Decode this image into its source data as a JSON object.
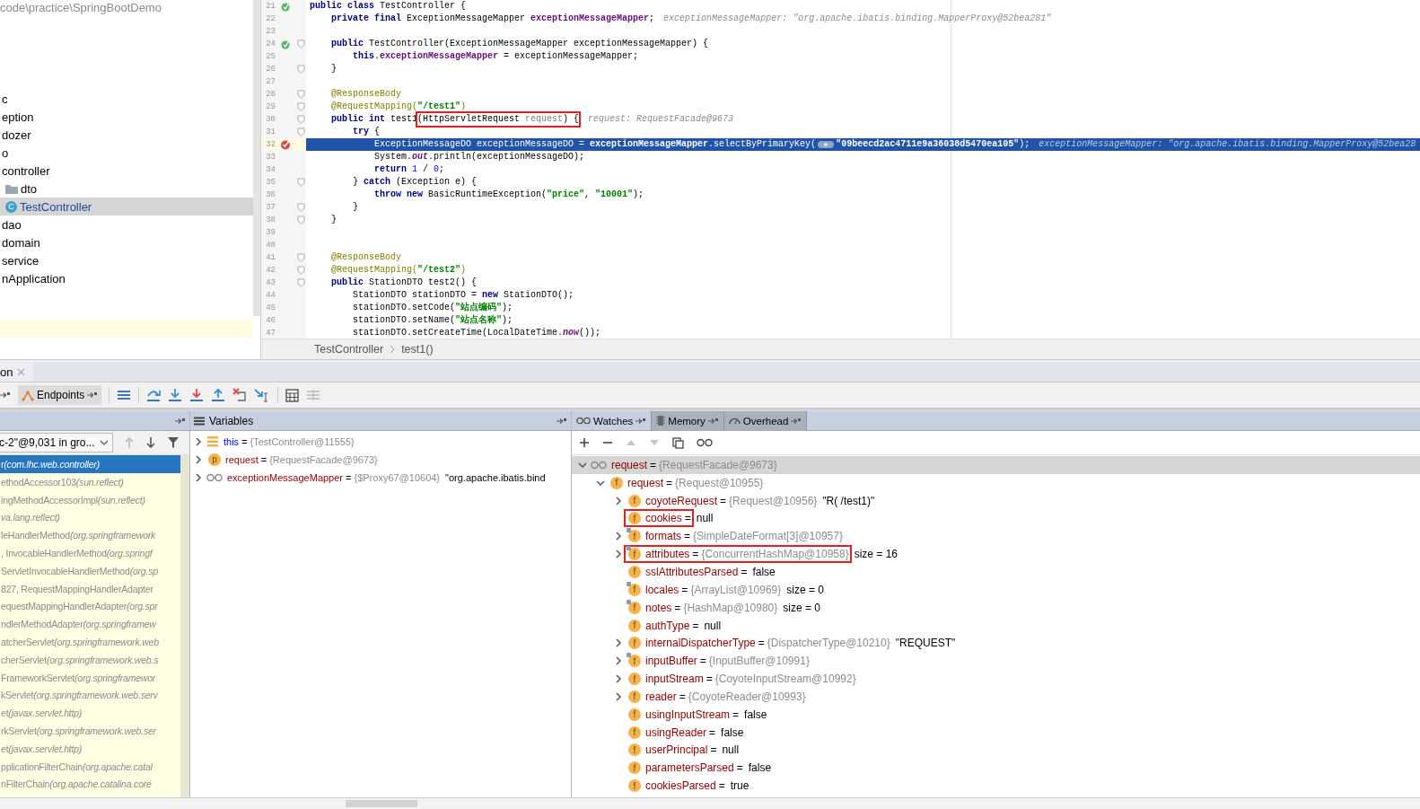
{
  "project_tree": {
    "path": "code\\practice\\SpringBootDemo",
    "items": [
      {
        "label": "c",
        "selected": false
      },
      {
        "label": "eption",
        "selected": false
      },
      {
        "label": "dozer",
        "selected": false
      },
      {
        "label": "o",
        "selected": false
      },
      {
        "label": "controller",
        "selected": false,
        "children": [
          {
            "label": "dto",
            "kind": "folder",
            "selected": false
          },
          {
            "label": "TestController",
            "kind": "class",
            "icon_letter": "C",
            "selected": true
          }
        ]
      },
      {
        "label": "dao",
        "selected": false
      },
      {
        "label": "domain",
        "selected": false
      },
      {
        "label": "service",
        "selected": false
      },
      {
        "label": "nApplication",
        "selected": false
      }
    ]
  },
  "editor": {
    "lines": [
      {
        "number": "21",
        "gutter": {
          "kind": "bean"
        },
        "fold": false,
        "current": false,
        "segments": [
          {
            "kind": "kw",
            "text": "public class"
          },
          {
            "kind": "plain",
            "text": " TestController {"
          }
        ]
      },
      {
        "number": "22",
        "fold": false,
        "current": false,
        "segments": [
          {
            "kind": "kw",
            "text": "    private final"
          },
          {
            "kind": "plain",
            "text": " ExceptionMessageMapper "
          },
          {
            "kind": "field",
            "text": "exceptionMessageMapper"
          },
          {
            "kind": "plain",
            "text": ";"
          },
          {
            "kind": "hint",
            "text": "exceptionMessageMapper: \"org.apache.ibatis.binding.MapperProxy@52bea281\""
          }
        ]
      },
      {
        "number": "23",
        "fold": false,
        "current": false
      },
      {
        "number": "24",
        "gutter": {
          "kind": "bean"
        },
        "fold": true,
        "current": false,
        "segments": [
          {
            "kind": "kw",
            "text": "    public"
          },
          {
            "kind": "plain",
            "text": " TestController(ExceptionMessageMapper exceptionMessageMapper) {"
          }
        ]
      },
      {
        "number": "25",
        "fold": false,
        "current": false,
        "segments": [
          {
            "kind": "kw",
            "text": "        this"
          },
          {
            "kind": "plain",
            "text": "."
          },
          {
            "kind": "field",
            "text": "exceptionMessageMapper"
          },
          {
            "kind": "plain",
            "text": " = exceptionMessageMapper;"
          }
        ]
      },
      {
        "number": "26",
        "fold": true,
        "current": false,
        "segments": [
          {
            "kind": "plain",
            "text": "    }"
          }
        ]
      },
      {
        "number": "27",
        "fold": false,
        "current": false
      },
      {
        "number": "28",
        "fold": true,
        "current": false,
        "segments": [
          {
            "kind": "anno",
            "text": "    @ResponseBody"
          }
        ]
      },
      {
        "number": "29",
        "fold": true,
        "current": false,
        "segments": [
          {
            "kind": "anno",
            "text": "    @RequestMapping("
          },
          {
            "kind": "str",
            "text": "\"/test1\""
          },
          {
            "kind": "anno",
            "text": ")"
          }
        ]
      },
      {
        "number": "30",
        "fold": true,
        "current": false,
        "segments": [
          {
            "kind": "kw",
            "text": "    public int"
          },
          {
            "kind": "plain",
            "text": " test1"
          },
          {
            "kind": "boxed",
            "segments": [
              {
                "kind": "plain",
                "text": "(HttpServletRequest "
              },
              {
                "kind": "unused",
                "text": "request"
              },
              {
                "kind": "plain",
                "text": ") {"
              }
            ]
          },
          {
            "kind": "hint",
            "text": "request: RequestFacade@9673"
          }
        ]
      },
      {
        "number": "31",
        "fold": true,
        "current": false,
        "segments": [
          {
            "kind": "kw",
            "text": "        try"
          },
          {
            "kind": "plain",
            "text": " {"
          }
        ]
      },
      {
        "number": "32",
        "gutter": {
          "kind": "breakpoint"
        },
        "fold": false,
        "current": true,
        "segments": [
          {
            "kind": "plain",
            "text": "            ExceptionMessageDO exceptionMessageDO = "
          },
          {
            "kind": "field",
            "text": "exceptionMessageMapper"
          },
          {
            "kind": "plain",
            "text": ".selectByPrimaryKey("
          },
          {
            "kind": "chip"
          },
          {
            "kind": "str",
            "text": "\"09beecd2ac4711e9a36038d5470ea105\""
          },
          {
            "kind": "plain",
            "text": ");"
          },
          {
            "kind": "hint",
            "text": "exceptionMessageMapper: \"org.apache.ibatis.binding.MapperProxy@52bea28"
          }
        ]
      },
      {
        "number": "33",
        "fold": false,
        "current": false,
        "segments": [
          {
            "kind": "plain",
            "text": "            System."
          },
          {
            "kind": "static",
            "text": "out"
          },
          {
            "kind": "plain",
            "text": ".println(exceptionMessageDO);"
          }
        ]
      },
      {
        "number": "34",
        "fold": false,
        "current": false,
        "segments": [
          {
            "kind": "kw",
            "text": "            return"
          },
          {
            "kind": "num",
            "text": " 1"
          },
          {
            "kind": "plain",
            "text": " / "
          },
          {
            "kind": "num",
            "text": "0"
          },
          {
            "kind": "plain",
            "text": ";"
          }
        ]
      },
      {
        "number": "35",
        "fold": true,
        "current": false,
        "segments": [
          {
            "kind": "plain",
            "text": "        } "
          },
          {
            "kind": "kw",
            "text": "catch"
          },
          {
            "kind": "plain",
            "text": " (Exception e) {"
          }
        ]
      },
      {
        "number": "36",
        "fold": false,
        "current": false,
        "segments": [
          {
            "kind": "kw",
            "text": "            throw new"
          },
          {
            "kind": "plain",
            "text": " BasicRuntimeException("
          },
          {
            "kind": "str",
            "text": "\"price\""
          },
          {
            "kind": "plain",
            "text": ", "
          },
          {
            "kind": "str",
            "text": "\"10001\""
          },
          {
            "kind": "plain",
            "text": ");"
          }
        ]
      },
      {
        "number": "37",
        "fold": true,
        "current": false,
        "segments": [
          {
            "kind": "plain",
            "text": "        }"
          }
        ]
      },
      {
        "number": "38",
        "fold": true,
        "current": false,
        "segments": [
          {
            "kind": "plain",
            "text": "    }"
          }
        ]
      },
      {
        "number": "39",
        "fold": false,
        "current": false
      },
      {
        "number": "40",
        "fold": false,
        "current": false
      },
      {
        "number": "41",
        "fold": true,
        "current": false,
        "segments": [
          {
            "kind": "anno",
            "text": "    @ResponseBody"
          }
        ]
      },
      {
        "number": "42",
        "fold": true,
        "current": false,
        "segments": [
          {
            "kind": "anno",
            "text": "    @RequestMapping("
          },
          {
            "kind": "str",
            "text": "\"/test2\""
          },
          {
            "kind": "anno",
            "text": ")"
          }
        ]
      },
      {
        "number": "43",
        "fold": true,
        "current": false,
        "segments": [
          {
            "kind": "kw",
            "text": "    public"
          },
          {
            "kind": "plain",
            "text": " StationDTO test2() {"
          }
        ]
      },
      {
        "number": "44",
        "fold": false,
        "current": false,
        "segments": [
          {
            "kind": "plain",
            "text": "        StationDTO stationDTO = "
          },
          {
            "kind": "kw",
            "text": "new"
          },
          {
            "kind": "plain",
            "text": " StationDTO();"
          }
        ]
      },
      {
        "number": "45",
        "fold": false,
        "current": false,
        "segments": [
          {
            "kind": "plain",
            "text": "        stationDTO.setCode("
          },
          {
            "kind": "str",
            "text": "\"站点编码\""
          },
          {
            "kind": "plain",
            "text": ");"
          }
        ]
      },
      {
        "number": "46",
        "fold": false,
        "current": false,
        "segments": [
          {
            "kind": "plain",
            "text": "        stationDTO.setName("
          },
          {
            "kind": "str",
            "text": "\"站点名称\""
          },
          {
            "kind": "plain",
            "text": ");"
          }
        ]
      },
      {
        "number": "47",
        "fold": false,
        "current": false,
        "segments": [
          {
            "kind": "plain",
            "text": "        stationDTO.setCreateTime(LocalDateTime."
          },
          {
            "kind": "static",
            "text": "now"
          },
          {
            "kind": "plain",
            "text": "());"
          }
        ]
      }
    ],
    "breadcrumb": [
      "TestController",
      "test1()"
    ]
  },
  "debug_tab": {
    "label": "on"
  },
  "toolbar": {
    "endpoints": "Endpoints"
  },
  "variables_title": "Variables",
  "watch_tabs": [
    {
      "label": "Watches",
      "kind": "watches",
      "selected": true
    },
    {
      "label": "Memory",
      "kind": "memory",
      "selected": false
    },
    {
      "label": "Overhead",
      "kind": "overhead",
      "selected": false
    }
  ],
  "frames": {
    "thread": "c-2\"@9,031 in gro...",
    "items": [
      {
        "method": "r",
        "package": "(com.lhc.web.controller)",
        "selected": true
      },
      {
        "method": "ethodAccessor103",
        "package": "(sun.reflect)",
        "selected": false
      },
      {
        "method": "ingMethodAccessorImpl",
        "package": "(sun.reflect)",
        "selected": false
      },
      {
        "package": "va.lang.reflect)",
        "selected": false
      },
      {
        "method": "leHandlerMethod",
        "package": "(org.springframework",
        "selected": false
      },
      {
        "method": ", InvocableHandlerMethod",
        "package": "(org.springf",
        "selected": false
      },
      {
        "method": "ServletInvocableHandlerMethod",
        "package": "(org.sp",
        "selected": false
      },
      {
        "method": "827, RequestMappingHandlerAdapter",
        "selected": false
      },
      {
        "method": "equestMappingHandlerAdapter",
        "package": "(org.spr",
        "selected": false
      },
      {
        "method": "ndlerMethodAdapter",
        "package": "(org.springframew",
        "selected": false
      },
      {
        "method": "atcherServlet",
        "package": "(org.springframework.web",
        "selected": false
      },
      {
        "method": "cherServlet",
        "package": "(org.springframework.web.s",
        "selected": false
      },
      {
        "method": "FrameworkServlet",
        "package": "(org.springframewor",
        "selected": false
      },
      {
        "method": "kServlet",
        "package": "(org.springframework.web.serv",
        "selected": false
      },
      {
        "method": "et",
        "package": "(javax.servlet.http)",
        "selected": false
      },
      {
        "method": "rkServlet",
        "package": "(org.springframework.web.ser",
        "selected": false
      },
      {
        "method": "et",
        "package": "(javax.servlet.http)",
        "selected": false
      },
      {
        "method": "pplicationFilterChain",
        "package": "(org.apache.catal",
        "selected": false
      },
      {
        "method": "nFilterChain",
        "package": "(org.apache.catalina.core",
        "selected": false
      }
    ]
  },
  "variables": [
    {
      "kind": "this",
      "name": "this",
      "equals": "=",
      "value": "{TestController@11555}",
      "expanded": false
    },
    {
      "kind": "param",
      "icon_letter": "p",
      "name": "request",
      "equals": "=",
      "value": "{RequestFacade@9673}",
      "expanded": false
    },
    {
      "kind": "watch",
      "name": "exceptionMessageMapper",
      "equals": "=",
      "value": "{$Proxy67@10604}",
      "extra": "\"org.apache.ibatis.bind",
      "expanded": false
    }
  ],
  "watches": [
    {
      "kind": "watch",
      "name": "request",
      "equals": "=",
      "value": "{RequestFacade@9673}",
      "expandable": true,
      "expanded": true,
      "selected": true,
      "marked": false,
      "boxed": false,
      "children": [
        {
          "kind": "field",
          "icon_letter": "f",
          "name": "request",
          "equals": "=",
          "value": "{Request@10955}",
          "expandable": true,
          "expanded": true,
          "selected": false,
          "marked": false,
          "boxed": false,
          "children": [
            {
              "kind": "field",
              "icon_letter": "f",
              "name": "coyoteRequest",
              "equals": "=",
              "value": "{Request@10956}",
              "extra": "\"R( /test1)\"",
              "expandable": true,
              "expanded": false,
              "selected": false,
              "marked": false,
              "boxed": false
            },
            {
              "kind": "field",
              "icon_letter": "f",
              "name": "cookies",
              "equals": "=",
              "extra": "null",
              "expandable": false,
              "expanded": false,
              "selected": false,
              "marked": false,
              "boxed": true
            },
            {
              "kind": "field",
              "icon_letter": "f",
              "name": "formats",
              "equals": "=",
              "value": "{SimpleDateFormat[3]@10957}",
              "expandable": true,
              "expanded": false,
              "selected": false,
              "marked": true,
              "boxed": false
            },
            {
              "kind": "field",
              "icon_letter": "f",
              "name": "attributes",
              "equals": "=",
              "value": "{ConcurrentHashMap@10958}",
              "extra": "size = 16",
              "expandable": true,
              "expanded": false,
              "selected": false,
              "marked": true,
              "boxed": true
            },
            {
              "kind": "field",
              "icon_letter": "f",
              "name": "sslAttributesParsed",
              "equals": "=",
              "extra": "false",
              "expandable": false,
              "expanded": false,
              "selected": false,
              "marked": false,
              "boxed": false
            },
            {
              "kind": "field",
              "icon_letter": "f",
              "name": "locales",
              "equals": "=",
              "value": "{ArrayList@10969}",
              "extra": "size = 0",
              "expandable": false,
              "expanded": false,
              "selected": false,
              "marked": true,
              "boxed": false
            },
            {
              "kind": "field",
              "icon_letter": "f",
              "name": "notes",
              "equals": "=",
              "value": "{HashMap@10980}",
              "extra": "size = 0",
              "expandable": false,
              "expanded": false,
              "selected": false,
              "marked": true,
              "boxed": false
            },
            {
              "kind": "field",
              "icon_letter": "f",
              "name": "authType",
              "equals": "=",
              "extra": "null",
              "expandable": false,
              "expanded": false,
              "selected": false,
              "marked": false,
              "boxed": false
            },
            {
              "kind": "field",
              "icon_letter": "f",
              "name": "internalDispatcherType",
              "equals": "=",
              "value": "{DispatcherType@10210}",
              "extra": "\"REQUEST\"",
              "expandable": true,
              "expanded": false,
              "selected": false,
              "marked": false,
              "boxed": false
            },
            {
              "kind": "field",
              "icon_letter": "f",
              "name": "inputBuffer",
              "equals": "=",
              "value": "{InputBuffer@10991}",
              "expandable": true,
              "expanded": false,
              "selected": false,
              "marked": true,
              "boxed": false
            },
            {
              "kind": "field",
              "icon_letter": "f",
              "name": "inputStream",
              "equals": "=",
              "value": "{CoyoteInputStream@10992}",
              "expandable": true,
              "expanded": false,
              "selected": false,
              "marked": false,
              "boxed": false
            },
            {
              "kind": "field",
              "icon_letter": "f",
              "name": "reader",
              "equals": "=",
              "value": "{CoyoteReader@10993}",
              "expandable": true,
              "expanded": false,
              "selected": false,
              "marked": false,
              "boxed": false
            },
            {
              "kind": "field",
              "icon_letter": "f",
              "name": "usingInputStream",
              "equals": "=",
              "extra": "false",
              "expandable": false,
              "expanded": false,
              "selected": false,
              "marked": false,
              "boxed": false
            },
            {
              "kind": "field",
              "icon_letter": "f",
              "name": "usingReader",
              "equals": "=",
              "extra": "false",
              "expandable": false,
              "expanded": false,
              "selected": false,
              "marked": false,
              "boxed": false
            },
            {
              "kind": "field",
              "icon_letter": "f",
              "name": "userPrincipal",
              "equals": "=",
              "extra": "null",
              "expandable": false,
              "expanded": false,
              "selected": false,
              "marked": false,
              "boxed": false
            },
            {
              "kind": "field",
              "icon_letter": "f",
              "name": "parametersParsed",
              "equals": "=",
              "extra": "false",
              "expandable": false,
              "expanded": false,
              "selected": false,
              "marked": false,
              "boxed": false
            },
            {
              "kind": "field",
              "icon_letter": "f",
              "name": "cookiesParsed",
              "equals": "=",
              "extra": "true",
              "expandable": false,
              "expanded": false,
              "selected": false,
              "marked": false,
              "boxed": false
            }
          ]
        }
      ]
    }
  ]
}
